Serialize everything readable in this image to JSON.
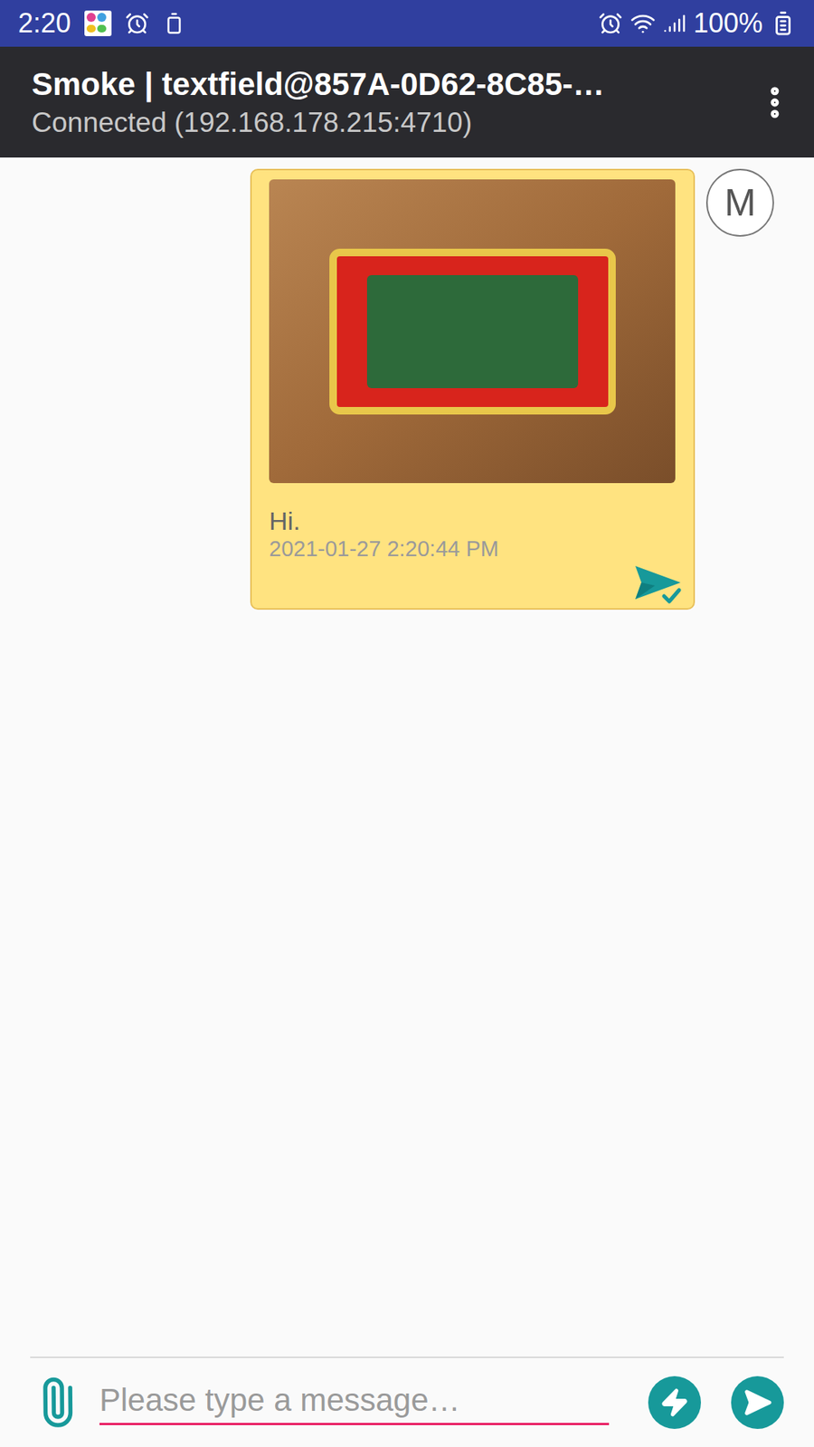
{
  "status_bar": {
    "time": "2:20",
    "battery": "100%"
  },
  "app_bar": {
    "title": "Smoke | textfield@857A-0D62-8C85-…",
    "subtitle": "Connected (192.168.178.215:4710)"
  },
  "messages": [
    {
      "avatar": "M",
      "text": "Hi.",
      "timestamp": "2021-01-27 2:20:44 PM",
      "has_image": true,
      "delivered": true
    }
  ],
  "composer": {
    "placeholder": "Please type a message…"
  }
}
